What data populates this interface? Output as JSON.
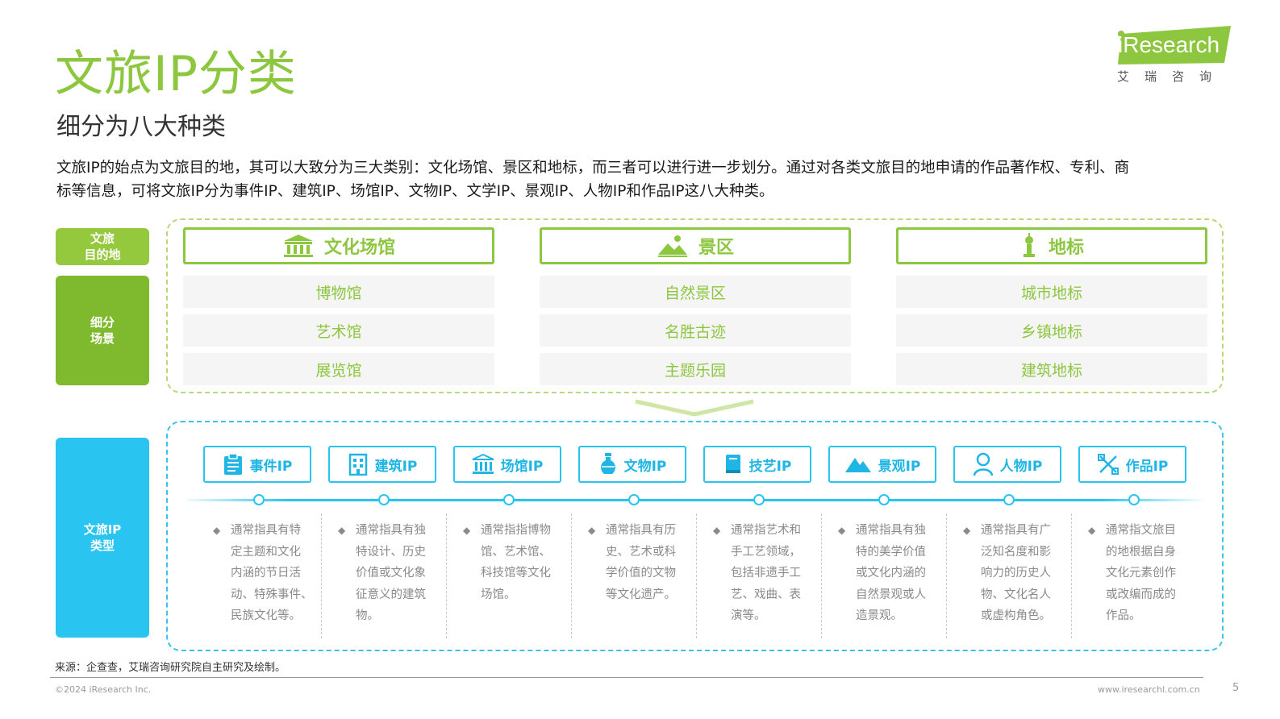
{
  "title": "文旅IP分类",
  "subtitle": "细分为八大种类",
  "intro": [
    "文旅IP的始点为文旅目的地，其可以大致分为三大类别：文化场馆、景区和地标，而三者可以进行进一步划分。通过对各类文旅目的地申请的作品著作权、专利、商",
    "标等信息，可将文旅IP分为事件IP、建筑IP、场馆IP、文物IP、文学IP、景观IP、人物IP和作品IP这八大种类。"
  ],
  "logo": {
    "brand": "iResearch",
    "sub": "艾瑞咨询",
    "color": "#8dc63f"
  },
  "labels": {
    "destination": [
      "文旅",
      "目的地"
    ],
    "scene": [
      "细分",
      "场景"
    ],
    "ip_type": [
      "文旅IP",
      "类型"
    ]
  },
  "categories": [
    {
      "name": "文化场馆",
      "icon": "museum-icon",
      "items": [
        "博物馆",
        "艺术馆",
        "展览馆"
      ]
    },
    {
      "name": "景区",
      "icon": "landscape-icon",
      "items": [
        "自然景区",
        "名胜古迹",
        "主题乐园"
      ]
    },
    {
      "name": "地标",
      "icon": "tower-icon",
      "items": [
        "城市地标",
        "乡镇地标",
        "建筑地标"
      ]
    }
  ],
  "ip_types": [
    {
      "name": "事件IP",
      "icon": "clipboard-icon",
      "desc": [
        "通常指具有特",
        "定主题和文化",
        "内涵的节日活",
        "动、特殊事件、",
        "民族文化等。"
      ]
    },
    {
      "name": "建筑IP",
      "icon": "building-icon",
      "desc": [
        "通常指具有独",
        "特设计、历史",
        "价值或文化象",
        "征意义的建筑",
        "物。"
      ]
    },
    {
      "name": "场馆IP",
      "icon": "venue-icon",
      "desc": [
        "通常指指博物",
        "馆、艺术馆、",
        "科技馆等文化",
        "场馆。"
      ]
    },
    {
      "name": "文物IP",
      "icon": "vase-icon",
      "desc": [
        "通常指具有历",
        "史、艺术或科",
        "学价值的文物",
        "等文化遗产。"
      ]
    },
    {
      "name": "技艺IP",
      "icon": "book-icon",
      "desc": [
        "通常指艺术和",
        "手工艺领域，",
        "包括非遗手工",
        "艺、戏曲、表",
        "演等。"
      ]
    },
    {
      "name": "景观IP",
      "icon": "mountain-icon",
      "desc": [
        "通常指具有独",
        "特的美学价值",
        "或文化内涵的",
        "自然景观或人",
        "造景观。"
      ]
    },
    {
      "name": "人物IP",
      "icon": "person-icon",
      "desc": [
        "通常指具有广",
        "泛知名度和影",
        "响力的历史人",
        "物、文化名人",
        "或虚构角色。"
      ]
    },
    {
      "name": "作品IP",
      "icon": "tools-icon",
      "desc": [
        "通常指文旅目",
        "的地根据自身",
        "文化元素创作",
        "或改编而成的",
        "作品。"
      ]
    }
  ],
  "source": "来源：企查查，艾瑞咨询研究院自主研究及绘制。",
  "copyright": "©2024 iResearch Inc.",
  "website": "www.iresearchl.com.cn",
  "page_number": "5"
}
